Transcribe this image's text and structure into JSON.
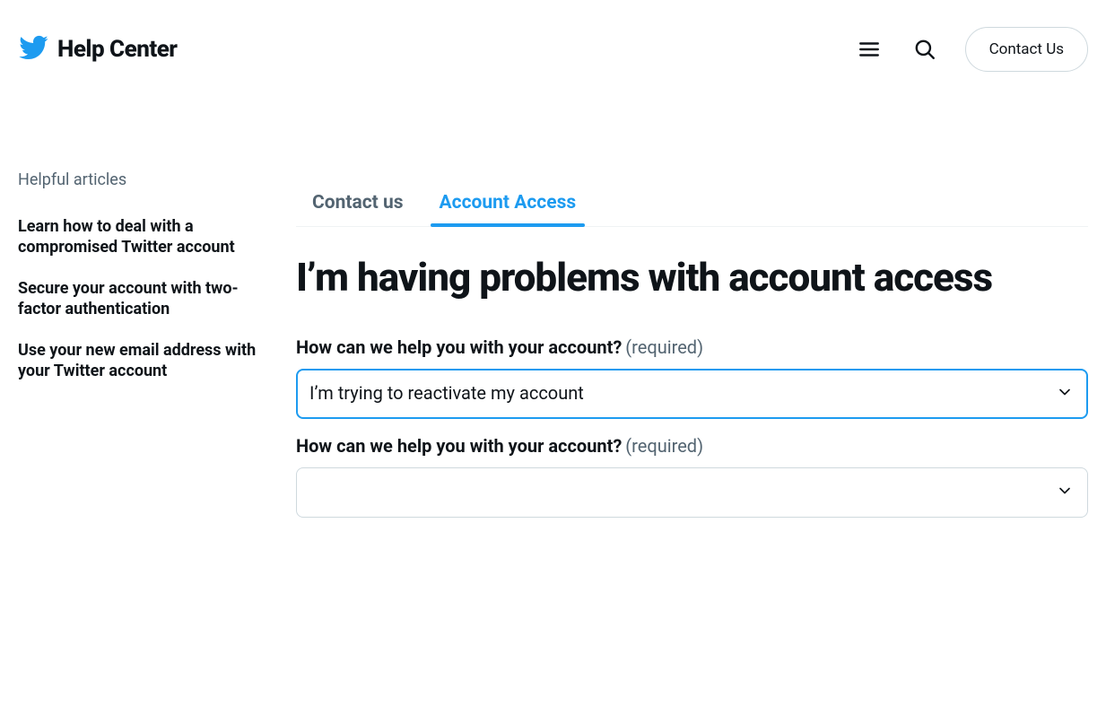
{
  "header": {
    "title": "Help Center",
    "contact_button": "Contact Us"
  },
  "sidebar": {
    "heading": "Helpful articles",
    "articles": [
      "Learn how to deal with a compromised Twitter account",
      "Secure your account with two-factor authentication",
      "Use your new email address with your Twitter account"
    ]
  },
  "breadcrumb": {
    "items": [
      "Contact us",
      "Account Access"
    ],
    "active_index": 1
  },
  "main": {
    "heading": "I’m having problems with account access",
    "fields": [
      {
        "label": "How can we help you with your account?",
        "required_text": "(required)",
        "value": "I’m trying to reactivate my account",
        "focused": true
      },
      {
        "label": "How can we help you with your account?",
        "required_text": "(required)",
        "value": "",
        "focused": false
      }
    ]
  }
}
